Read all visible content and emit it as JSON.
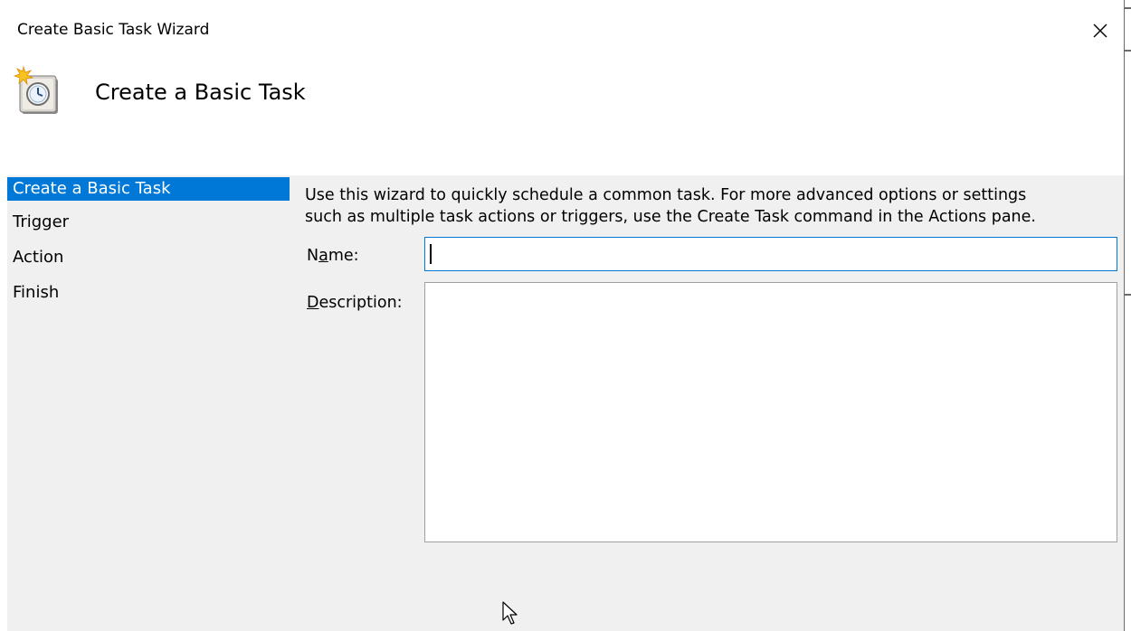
{
  "window": {
    "title": "Create Basic Task Wizard",
    "close_glyph": "×"
  },
  "header": {
    "title": "Create a Basic Task",
    "icon": "task-scheduler-clock-icon"
  },
  "steps": [
    {
      "label": "Create a Basic Task",
      "selected": true
    },
    {
      "label": "Trigger",
      "selected": false
    },
    {
      "label": "Action",
      "selected": false
    },
    {
      "label": "Finish",
      "selected": false
    }
  ],
  "intro": {
    "line1": "Use this wizard to quickly schedule a common task.  For more advanced options or settings",
    "line2": "such as multiple task actions or triggers, use the Create Task command in the Actions pane."
  },
  "form": {
    "name_label_pre": "N",
    "name_label_accel": "a",
    "name_label_post": "me:",
    "name_value": "",
    "description_label_accel": "D",
    "description_label_post": "escription:",
    "description_value": ""
  },
  "colors": {
    "selection": "#0078d7",
    "body_bg": "#f0f0f0",
    "input_focus_border": "#0078d7",
    "input_border": "#a0a0a0"
  }
}
